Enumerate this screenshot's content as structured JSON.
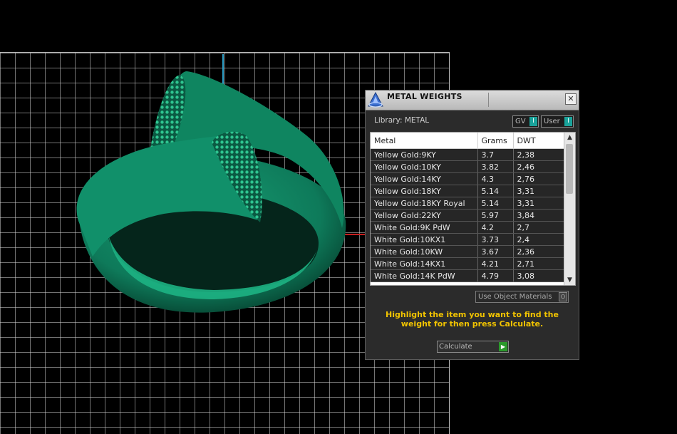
{
  "panel": {
    "title": "METAL WEIGHTS",
    "close_icon": "close-icon",
    "library_label": "Library: METAL",
    "gv_toggle_label": "GV",
    "user_toggle_label": "User",
    "toggle_knob": "I",
    "use_object_materials_label": "Use Object Materials",
    "use_object_materials_knob": "O",
    "instruction": "Highlight the item you want to find the weight for then press Calculate.",
    "calculate_label": "Calculate",
    "calculate_arrow": "▶"
  },
  "table": {
    "columns": [
      "Metal",
      "Grams",
      "DWT"
    ],
    "rows": [
      [
        "Yellow Gold:9KY",
        "3.7",
        "2,38"
      ],
      [
        "Yellow Gold:10KY",
        "3.82",
        "2,46"
      ],
      [
        "Yellow Gold:14KY",
        "4.3",
        "2,76"
      ],
      [
        "Yellow Gold:18KY",
        "5.14",
        "3,31"
      ],
      [
        "Yellow Gold:18KY Royal",
        "5.14",
        "3,31"
      ],
      [
        "Yellow Gold:22KY",
        "5.97",
        "3,84"
      ],
      [
        "White Gold:9K PdW",
        "4.2",
        "2,7"
      ],
      [
        "White Gold:10KX1",
        "3.73",
        "2,4"
      ],
      [
        "White Gold:10KW",
        "3.67",
        "2,36"
      ],
      [
        "White Gold:14KX1",
        "4.21",
        "2,71"
      ],
      [
        "White Gold:14K PdW",
        "4.79",
        "3,08"
      ]
    ],
    "scroll_up": "▲",
    "scroll_down": "▼"
  },
  "colors": {
    "ring": "#0e7a5a",
    "ring_dark": "#07402f",
    "axis_y": "#2fa0c8",
    "axis_x": "#c81e1e",
    "instruction": "#f2c400",
    "toggle_knob": "#1aa39b"
  }
}
